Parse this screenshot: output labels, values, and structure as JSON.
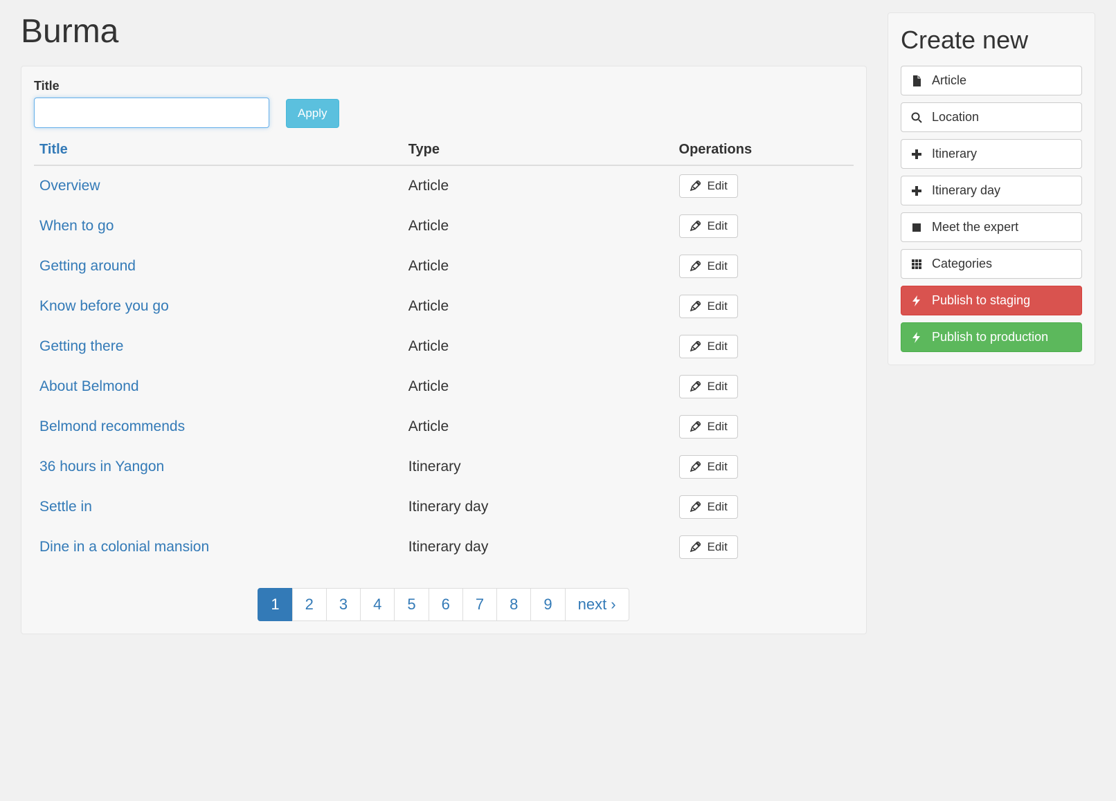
{
  "page": {
    "title": "Burma"
  },
  "filter": {
    "label": "Title",
    "value": "",
    "apply_label": "Apply"
  },
  "table": {
    "headers": {
      "title": "Title",
      "type": "Type",
      "operations": "Operations"
    },
    "edit_label": "Edit",
    "rows": [
      {
        "title": "Overview",
        "type": "Article"
      },
      {
        "title": "When to go",
        "type": "Article"
      },
      {
        "title": "Getting around",
        "type": "Article"
      },
      {
        "title": "Know before you go",
        "type": "Article"
      },
      {
        "title": "Getting there",
        "type": "Article"
      },
      {
        "title": "About Belmond",
        "type": "Article"
      },
      {
        "title": "Belmond recommends",
        "type": "Article"
      },
      {
        "title": "36 hours in Yangon",
        "type": "Itinerary"
      },
      {
        "title": "Settle in",
        "type": "Itinerary day"
      },
      {
        "title": "Dine in a colonial mansion",
        "type": "Itinerary day"
      }
    ]
  },
  "pagination": {
    "pages": [
      "1",
      "2",
      "3",
      "4",
      "5",
      "6",
      "7",
      "8",
      "9"
    ],
    "active_index": 0,
    "next_label": "next ›"
  },
  "sidebar": {
    "title": "Create new",
    "items": [
      {
        "icon": "file-icon",
        "label": "Article"
      },
      {
        "icon": "search-icon",
        "label": "Location"
      },
      {
        "icon": "plus-icon",
        "label": "Itinerary"
      },
      {
        "icon": "plus-icon",
        "label": "Itinerary day"
      },
      {
        "icon": "book-icon",
        "label": "Meet the expert"
      },
      {
        "icon": "grid-icon",
        "label": "Categories"
      }
    ],
    "publish_staging": "Publish to staging",
    "publish_production": "Publish to production"
  }
}
